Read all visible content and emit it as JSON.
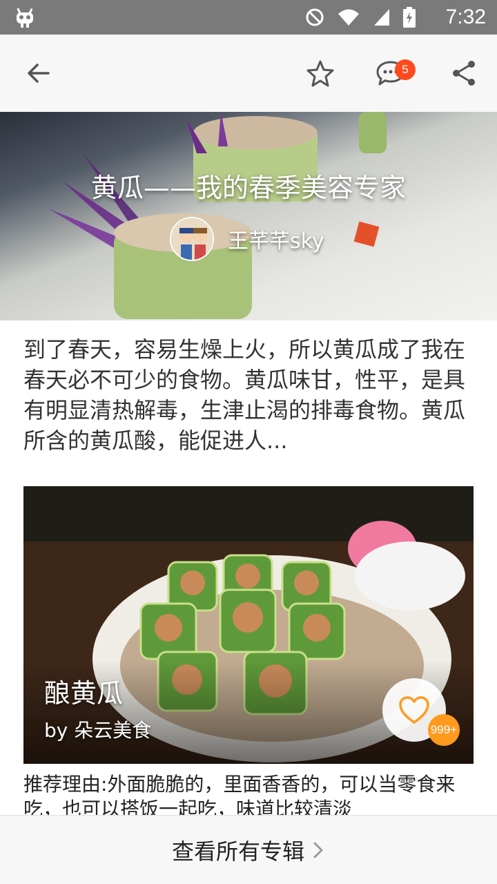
{
  "status_bar": {
    "time": "7:32",
    "icons": [
      "android-debug-icon",
      "do-not-disturb-icon",
      "wifi-icon",
      "signal-icon",
      "battery-charging-icon"
    ]
  },
  "app_bar": {
    "comment_count": "5"
  },
  "hero": {
    "title": "黄瓜——我的春季美容专家",
    "author": "王芊芊sky"
  },
  "description": "到了春天，容易生燥上火，所以黄瓜成了我在春天必不可少的食物。黄瓜味甘，性平，是具有明显清热解毒，生津止渴的排毒食物。黄瓜所含的黄瓜酸，能促进人...",
  "recipe_card": {
    "title": "酿黄瓜",
    "author": "by 朵云美食",
    "like_count": "999+",
    "reason": "推荐理由:外面脆脆的，里面香香的，可以当零食来吃，也可以搭饭一起吃，味道比较清淡"
  },
  "bottom": {
    "view_all_label": "查看所有专辑"
  },
  "colors": {
    "badge": "#ff4a1e",
    "like_badge": "#ff9a1e",
    "heart": "#ff9a1e"
  }
}
